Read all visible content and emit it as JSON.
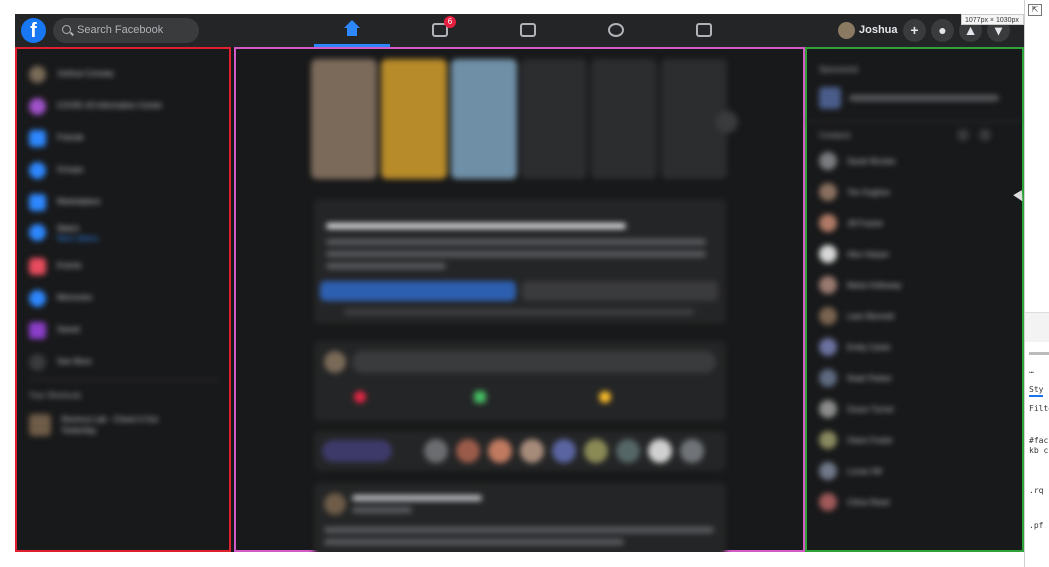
{
  "search": {
    "placeholder": "Search Facebook"
  },
  "nav": {
    "tabs": [
      {
        "name": "home",
        "active": true
      },
      {
        "name": "watch",
        "badge": "6"
      },
      {
        "name": "marketplace"
      },
      {
        "name": "groups"
      },
      {
        "name": "gaming"
      }
    ]
  },
  "profile": {
    "name": "Joshua"
  },
  "actions": {
    "create": "+"
  },
  "overlay": {
    "size_tip": "1077px × 1030px"
  },
  "left": {
    "items": [
      {
        "label": "Joshua Conway",
        "icon": "avatar",
        "color": "#7a6a58"
      },
      {
        "label": "COVID-19 Information Center",
        "icon": "covid-icon",
        "color": "#a052c9"
      },
      {
        "label": "Friends",
        "icon": "friends-icon",
        "color": "#2d88ff"
      },
      {
        "label": "Groups",
        "icon": "groups-icon",
        "color": "#2d88ff"
      },
      {
        "label": "Marketplace",
        "icon": "marketplace-icon",
        "color": "#2d88ff"
      },
      {
        "label": "Watch",
        "sub": "New videos",
        "icon": "watch-icon",
        "color": "#2d88ff"
      },
      {
        "label": "Events",
        "icon": "events-icon",
        "color": "#e84c5e"
      },
      {
        "label": "Memories",
        "icon": "memories-icon",
        "color": "#2d88ff"
      },
      {
        "label": "Saved",
        "icon": "saved-icon",
        "color": "#8b3ec9"
      },
      {
        "label": "See More",
        "icon": "chevron-down-icon",
        "color": "#3a3b3c"
      }
    ],
    "shortcuts_heading": "Your Shortcuts",
    "shortcut": {
      "label": "Shortcut Lab - Check It Out",
      "sub": "Yesterday"
    }
  },
  "feed": {
    "poll_title": "Joshua, take a COVID-19 Survey from Facebook",
    "poll_body": "Help researchers understand the spread of COVID-19 by taking part in this survey.",
    "poll_primary": "Take Survey",
    "poll_secondary": "Dismiss",
    "composer_placeholder": "What's on your mind, Joshua?",
    "composer_actions": [
      "Live Video",
      "Photo/Video",
      "Feeling/Activity"
    ],
    "room_label": "Create Room",
    "post_author": "Shortcut Lab - Check It Out"
  },
  "right": {
    "sponsored_heading": "Sponsored",
    "contacts_heading": "Contacts",
    "contacts": [
      "Sarah Brooks",
      "Tim Hughes",
      "Jill Frazier",
      "Alex Harper",
      "Maria Holloway",
      "Liam Bennett",
      "Emily Carter",
      "Noah Parker",
      "Grace Turner",
      "Owen Foster",
      "Lucas Hill",
      "Chloe Reed"
    ]
  },
  "devtools": {
    "tab_styles": "Sty",
    "filter": "Filte",
    "snippet_1": "#fac",
    "snippet_2": "kb c",
    "snippet_3": ".rq",
    "snippet_4": ".pf"
  }
}
